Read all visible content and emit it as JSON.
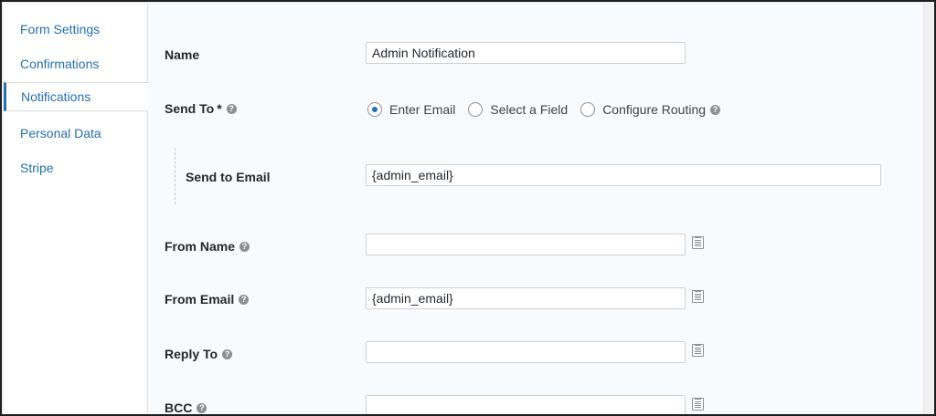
{
  "sidebar": {
    "items": [
      {
        "label": "Form Settings"
      },
      {
        "label": "Confirmations"
      },
      {
        "label": "Notifications"
      },
      {
        "label": "Personal Data"
      },
      {
        "label": "Stripe"
      }
    ],
    "active_index": 2
  },
  "form": {
    "name": {
      "label": "Name",
      "value": "Admin Notification"
    },
    "send_to": {
      "label": "Send To",
      "required_mark": "*",
      "options": [
        {
          "label": "Enter Email",
          "checked": true
        },
        {
          "label": "Select a Field",
          "checked": false
        },
        {
          "label": "Configure Routing",
          "checked": false
        }
      ]
    },
    "send_to_email": {
      "label": "Send to Email",
      "value": "{admin_email}"
    },
    "from_name": {
      "label": "From Name",
      "value": ""
    },
    "from_email": {
      "label": "From Email",
      "value": "{admin_email}"
    },
    "reply_to": {
      "label": "Reply To",
      "value": ""
    },
    "bcc": {
      "label": "BCC",
      "value": ""
    }
  },
  "icons": {
    "help": "question-circle-icon",
    "merge_tags": "merge-tag-icon"
  },
  "colors": {
    "link": "#2271b1",
    "text": "#23282d",
    "panel_bg": "#f7fbfd"
  }
}
